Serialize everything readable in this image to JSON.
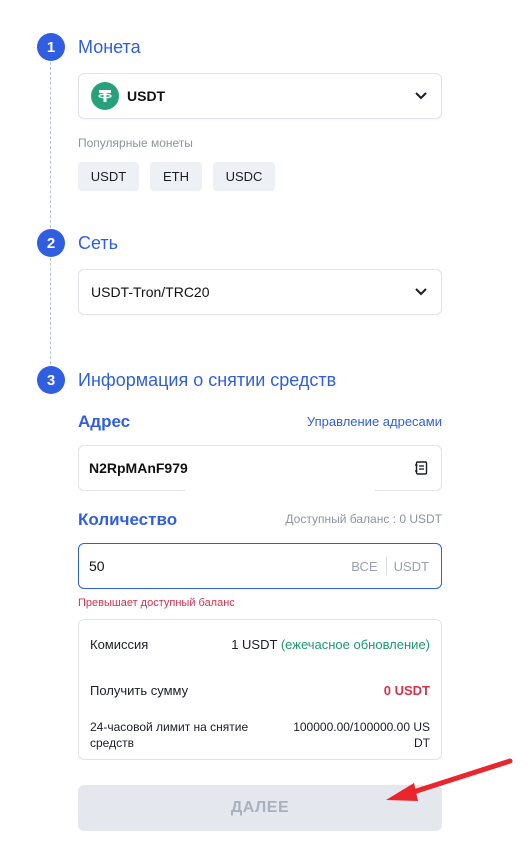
{
  "steps": [
    {
      "number": "1",
      "title": "Монета"
    },
    {
      "number": "2",
      "title": "Сеть"
    },
    {
      "number": "3",
      "title": "Информация о снятии средств"
    }
  ],
  "coin": {
    "selected": "USDT",
    "popular_label": "Популярные монеты",
    "popular": [
      "USDT",
      "ETH",
      "USDC"
    ]
  },
  "network": {
    "selected": "USDT-Tron/TRC20"
  },
  "address": {
    "label": "Адрес",
    "manage_link": "Управление адресами",
    "value": "N2RpMAnF979"
  },
  "amount": {
    "label": "Количество",
    "available": "Доступный баланс : 0 USDT",
    "value": "50",
    "max_label": "ВСЕ",
    "unit": "USDT",
    "error": "Превышает доступный баланс"
  },
  "summary": {
    "fee_label": "Комиссия",
    "fee_value": "1 USDT",
    "fee_note": "(ежечасное обновление)",
    "receive_label": "Получить сумму",
    "receive_value": "0 USDT",
    "limit_label": "24-часовой лимит на снятие средств",
    "limit_value": "100000.00/100000.00 USDT"
  },
  "next_button": "ДАЛЕЕ",
  "colors": {
    "accent": "#2f5fe0",
    "tether": "#26a17b",
    "error": "#d9304a",
    "positive": "#1a9a6c",
    "arrow": "#e8262b"
  }
}
